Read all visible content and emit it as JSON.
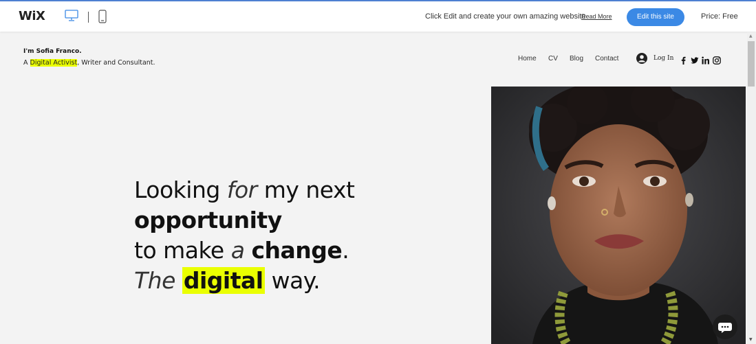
{
  "editor_bar": {
    "logo": "WiX",
    "desktop_icon": "desktop-icon",
    "mobile_icon": "mobile-icon",
    "promo_text": "Click Edit and create your own amazing website",
    "read_more": "Read More",
    "edit_button": "Edit this site",
    "price": "Price: Free",
    "accent_color": "#3b89e5"
  },
  "site_header": {
    "name": "I'm Sofia Franco.",
    "tagline_prefix": "A ",
    "tagline_highlight": "Digital Activist",
    "tagline_suffix": ", Writer and Consultant.",
    "highlight_color": "#eaff00"
  },
  "nav": {
    "items": [
      {
        "label": "Home"
      },
      {
        "label": "CV"
      },
      {
        "label": "Blog"
      },
      {
        "label": "Contact"
      }
    ],
    "login_label": "Log In",
    "login_icon": "user-avatar-icon",
    "social_icons": [
      "facebook-icon",
      "twitter-icon",
      "linkedin-icon",
      "instagram-icon"
    ]
  },
  "hero": {
    "line1_a": "Looking ",
    "line1_b": "for",
    "line1_c": " my next",
    "line2": "opportunity",
    "line3_a": "to make ",
    "line3_b": "a",
    "line3_c": " ",
    "line3_d": "change",
    "line3_e": ".",
    "line4_a": "The ",
    "line4_b": "digital",
    "line4_c": " way."
  },
  "chat": {
    "icon": "chat-bubble-icon"
  }
}
